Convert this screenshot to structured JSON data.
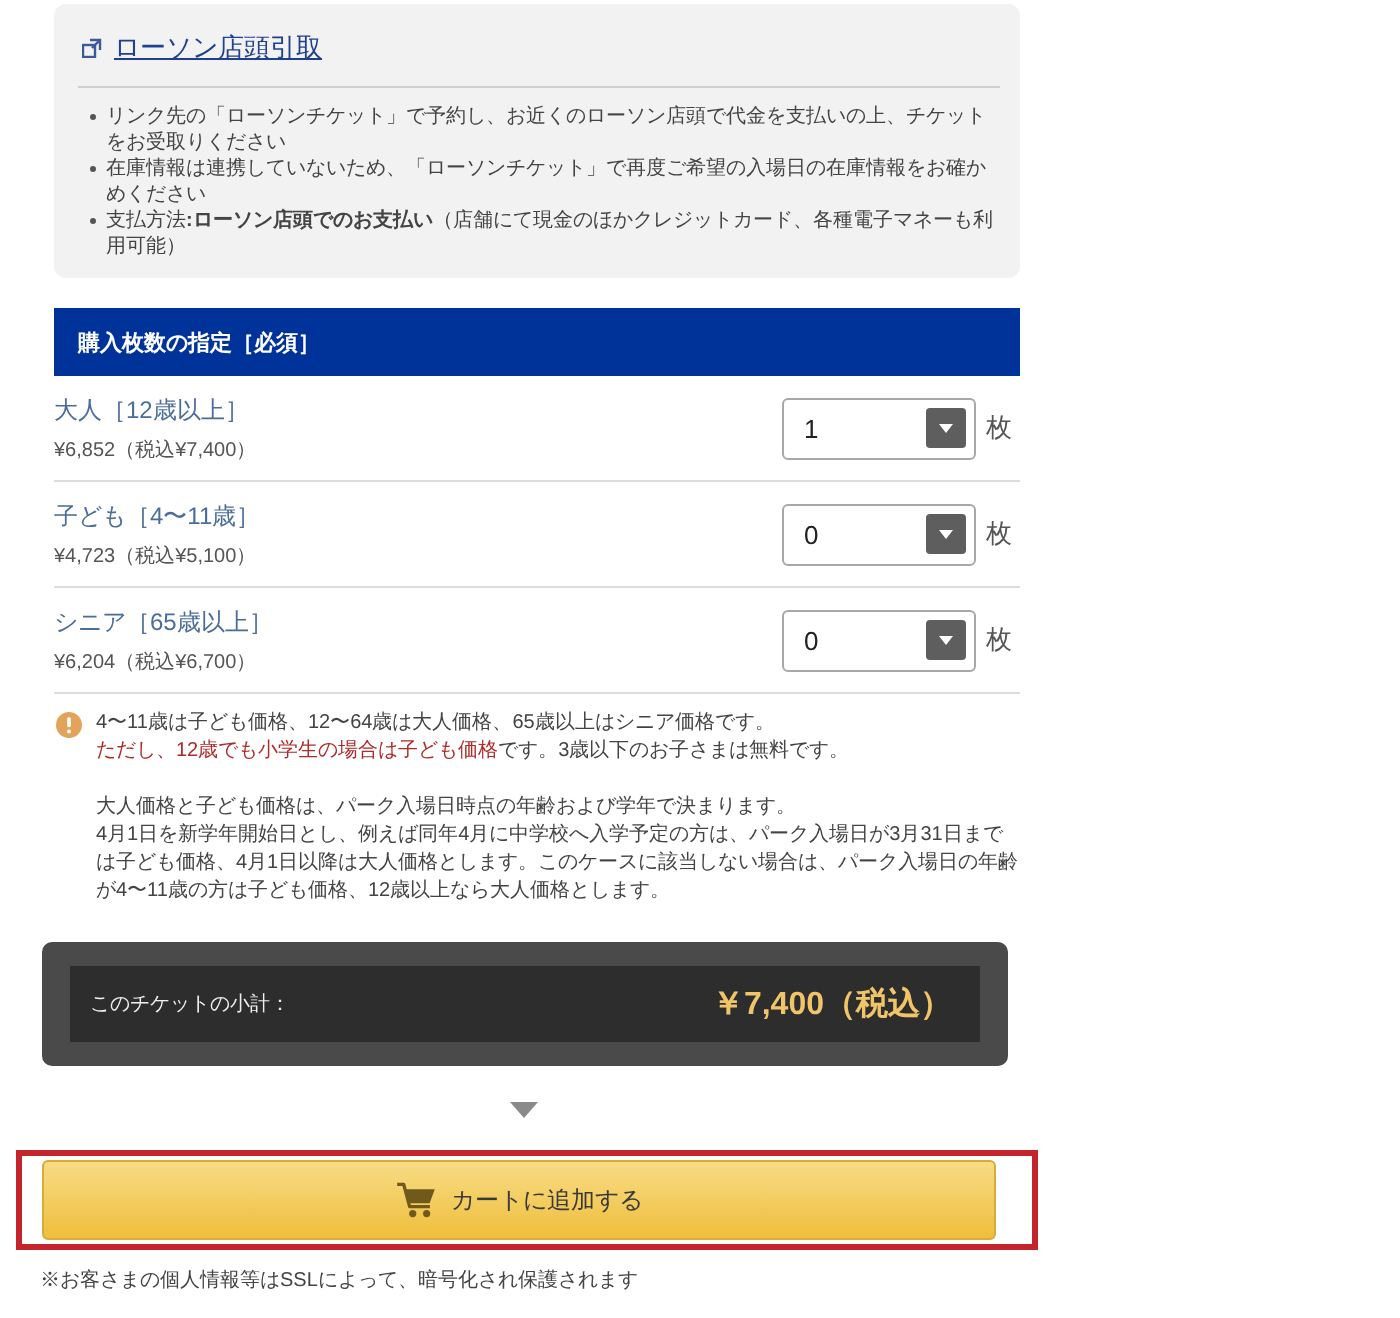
{
  "pickup_info": {
    "link": "ローソン店頭引取",
    "bullets": [
      "リンク先の「ローソンチケット」で予約し、お近くのローソン店頭で代金を支払いの上、チケットをお受取りください",
      "在庫情報は連携していないため、「ローソンチケット」で再度ご希望の入場日の在庫情報をお確かめください",
      "支払方法**:ローソン店頭でのお支払い**（店舗にて現金のほかクレジットカード、各種電子マネーも利用可能）"
    ]
  },
  "quantity": {
    "title": "購入枚数の指定［必須］",
    "rows": [
      {
        "label": "大人［12歳以上］",
        "price": "¥6,852（税込¥7,400）",
        "value": "1",
        "unit": "枚"
      },
      {
        "label": "子ども［4〜11歳］",
        "price": "¥4,723（税込¥5,100）",
        "value": "0",
        "unit": "枚"
      },
      {
        "label": "シニア［65歳以上］",
        "price": "¥6,204（税込¥6,700）",
        "value": "0",
        "unit": "枚"
      }
    ]
  },
  "notes": [
    {
      "lines": [
        {
          "parts": [
            {
              "text": "4〜11歳は子ども価格、12〜64歳は大人価格、65歳以上はシニア価格です。",
              "highlighted": false
            }
          ]
        },
        {
          "parts": [
            {
              "text": "ただし、12歳でも小学生の場合は子ども価格",
              "highlighted": true
            },
            {
              "text": "です。3歳以下のお子さまは無料です。",
              "highlighted": false
            }
          ]
        }
      ]
    },
    {
      "lines": [
        {
          "parts": [
            {
              "text": "大人価格と子ども価格は、パーク入場日時点の年齢および学年で決まります。",
              "highlighted": false
            }
          ]
        },
        {
          "parts": [
            {
              "text": "4月1日を新学年開始日とし、例えば同年4月に中学校へ入学予定の方は、パーク入場日が3月31日までは子ども価格、4月1日以降は大人価格とします。このケースに該当しない場合は、パーク入場日の年齢が4〜11歳の方は子ども価格、12歳以上なら大人価格とします。",
              "highlighted": false
            }
          ]
        }
      ]
    }
  ],
  "subtotal": {
    "label": "このチケットの小計：",
    "amount": "￥7,400（税込）"
  },
  "cart_button": {
    "label": "カートに追加する",
    "highlighted": true
  },
  "security_note": "※お客さまの個人情報等はSSLによって、暗号化され保護されます"
}
